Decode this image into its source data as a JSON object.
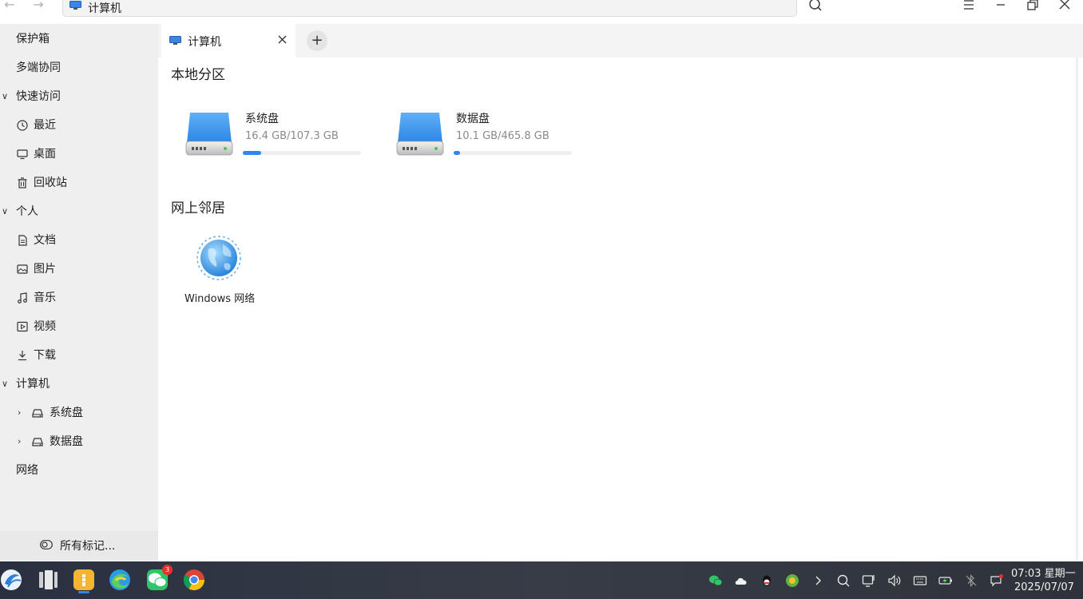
{
  "window": {
    "address_path": "计算机",
    "back_icon": "arrow-left-icon",
    "forward_icon": "arrow-right-icon",
    "search_icon": "search-icon",
    "menu_icon": "hamburger-menu-icon",
    "minimize_icon": "minimize-icon",
    "restore_icon": "restore-icon",
    "close_icon": "close-icon"
  },
  "sidebar": {
    "items": [
      {
        "label": "保护箱",
        "type": "top"
      },
      {
        "label": "多端协同",
        "type": "top"
      },
      {
        "label": "快速访问",
        "type": "group",
        "expanded": true
      },
      {
        "label": "最近",
        "icon": "clock-icon"
      },
      {
        "label": "桌面",
        "icon": "monitor-icon"
      },
      {
        "label": "回收站",
        "icon": "trash-icon"
      },
      {
        "label": "个人",
        "type": "group",
        "expanded": true
      },
      {
        "label": "文档",
        "icon": "document-icon"
      },
      {
        "label": "图片",
        "icon": "image-icon"
      },
      {
        "label": "音乐",
        "icon": "music-note-icon"
      },
      {
        "label": "视频",
        "icon": "video-icon"
      },
      {
        "label": "下载",
        "icon": "download-icon"
      },
      {
        "label": "计算机",
        "type": "group",
        "expanded": true
      },
      {
        "label": "系统盘",
        "icon": "drive-icon",
        "expanded": false
      },
      {
        "label": "数据盘",
        "icon": "drive-icon",
        "expanded": false
      },
      {
        "label": "网络",
        "type": "top"
      }
    ],
    "tags_label": "所有标记..."
  },
  "tabs": [
    {
      "label": "计算机",
      "icon": "computer-icon",
      "active": true
    }
  ],
  "new_tab_label": "+",
  "sections": {
    "local": "本地分区",
    "network": "网上邻居"
  },
  "drives": [
    {
      "name": "系统盘",
      "size": "16.4 GB/107.3 GB",
      "used_fraction": 0.153
    },
    {
      "name": "数据盘",
      "size": "10.1 GB/465.8 GB",
      "used_fraction": 0.022
    }
  ],
  "network_items": [
    {
      "label": "Windows 网络",
      "icon": "globe-icon"
    }
  ],
  "taskbar": {
    "apps": [
      "launcher-icon",
      "multitask-view-icon",
      "file-manager-icon",
      "edge-browser-icon",
      "wechat-icon",
      "chrome-icon"
    ],
    "wechat_badge": "3",
    "tray": [
      "wechat-tray-icon",
      "cloud-icon",
      "qq-icon",
      "green-app-icon",
      "chevron-right-icon",
      "search-tray-icon",
      "screen-cast-icon",
      "volume-icon",
      "keyboard-icon",
      "battery-icon",
      "bluetooth-off-icon",
      "notification-icon"
    ],
    "time": "07:03 星期一",
    "date": "2025/07/07"
  }
}
